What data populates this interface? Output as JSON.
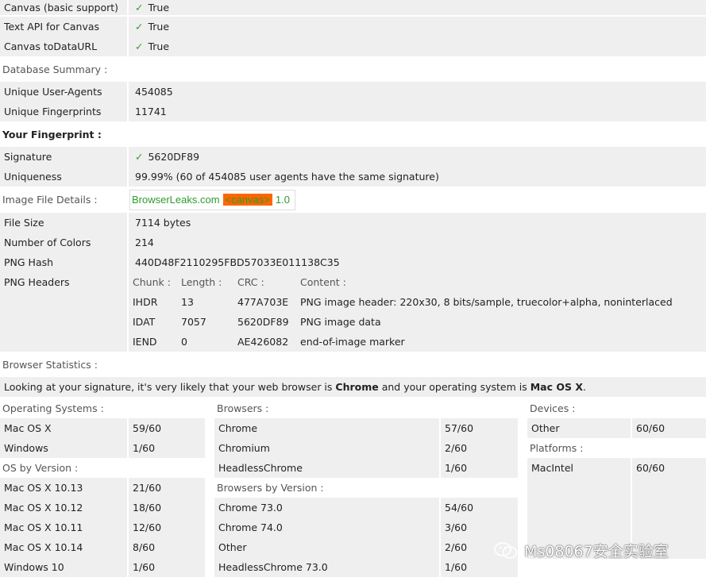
{
  "canvas_support": [
    {
      "label": "Canvas (basic support)",
      "value": "True"
    },
    {
      "label": "Text API for Canvas",
      "value": "True"
    },
    {
      "label": "Canvas toDataURL",
      "value": "True"
    }
  ],
  "database_summary": {
    "title": "Database Summary :",
    "rows": [
      {
        "label": "Unique User-Agents",
        "value": "454085"
      },
      {
        "label": "Unique Fingerprints",
        "value": "11741"
      }
    ]
  },
  "fingerprint": {
    "title": "Your Fingerprint :",
    "signature_label": "Signature",
    "signature": "5620DF89",
    "uniqueness_label": "Uniqueness",
    "uniqueness": "99.99% (60 of 454085 user agents have the same signature)"
  },
  "image_details": {
    "title": "Image File Details :",
    "canvas_text_a": "BrowserLeaks.com",
    "canvas_text_tag": "<canvas>",
    "canvas_text_b": "1.0",
    "rows": [
      {
        "label": "File Size",
        "value": "7114 bytes"
      },
      {
        "label": "Number of Colors",
        "value": "214"
      },
      {
        "label": "PNG Hash",
        "value": "440D48F2110295FBD57033E011138C35"
      }
    ],
    "png_headers_label": "PNG Headers",
    "png_columns": [
      "Chunk :",
      "Length :",
      "CRC :",
      "Content :"
    ],
    "png_rows": [
      [
        "IHDR",
        "13",
        "477A703E",
        "PNG image header: 220x30, 8 bits/sample, truecolor+alpha, noninterlaced"
      ],
      [
        "IDAT",
        "7057",
        "5620DF89",
        "PNG image data"
      ],
      [
        "IEND",
        "0",
        "AE426082",
        "end-of-image marker"
      ]
    ]
  },
  "browser_stats": {
    "title": "Browser Statistics :",
    "sentence_a": "Looking at your signature, it's very likely that your web browser is",
    "browser": "Chrome",
    "sentence_b": "and your operating system is",
    "os": "Mac OS X",
    "sentence_c": "."
  },
  "operating_systems": {
    "title": "Operating Systems :",
    "rows": [
      {
        "label": "Mac OS X",
        "value": "59/60"
      },
      {
        "label": "Windows",
        "value": "1/60"
      }
    ]
  },
  "os_by_version": {
    "title": "OS by Version :",
    "rows": [
      {
        "label": "Mac OS X 10.13",
        "value": "21/60"
      },
      {
        "label": "Mac OS X 10.12",
        "value": "18/60"
      },
      {
        "label": "Mac OS X 10.11",
        "value": "12/60"
      },
      {
        "label": "Mac OS X 10.14",
        "value": "8/60"
      },
      {
        "label": "Windows 10",
        "value": "1/60"
      }
    ]
  },
  "browsers": {
    "title": "Browsers :",
    "rows": [
      {
        "label": "Chrome",
        "value": "57/60"
      },
      {
        "label": "Chromium",
        "value": "2/60"
      },
      {
        "label": "HeadlessChrome",
        "value": "1/60"
      }
    ]
  },
  "browsers_by_version": {
    "title": "Browsers by Version :",
    "rows": [
      {
        "label": "Chrome 73.0",
        "value": "54/60"
      },
      {
        "label": "Chrome 74.0",
        "value": "3/60"
      },
      {
        "label": "Other",
        "value": "2/60"
      },
      {
        "label": "HeadlessChrome 73.0",
        "value": "1/60"
      }
    ]
  },
  "devices": {
    "title": "Devices :",
    "rows": [
      {
        "label": "Other",
        "value": "60/60"
      }
    ]
  },
  "platforms": {
    "title": "Platforms :",
    "rows": [
      {
        "label": "MacIntel",
        "value": "60/60"
      }
    ]
  },
  "watermark": "Ms08067安全实验室"
}
